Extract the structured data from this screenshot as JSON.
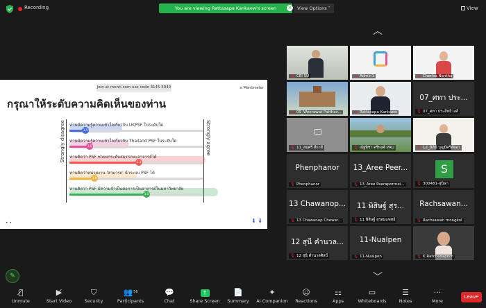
{
  "topbar": {
    "recording_label": "Recording",
    "viewing_banner": "You are viewing Rattasapa Kankaew's screen",
    "view_options": "View Options ˅",
    "view_label": "View"
  },
  "slide": {
    "code_text": "Join at menti.com  use code  3145 5940",
    "brand": "≡ Mentimeter",
    "title": "กรุณาให้ระดับความคิดเห็นของท่าน",
    "left_axis": "Strongly disagree",
    "right_axis": "Strongly agree",
    "footer_left": "•  •",
    "footer_right": "⬇ ⬇",
    "statements": [
      {
        "text": "ท่านมีความรู้ความเข้าใจเกี่ยวกับ UKPSF ในระดับใด",
        "value": "1.5",
        "level": 0.12,
        "color": "#4a6fd8"
      },
      {
        "text": "ท่านมีความรู้ความเข้าใจเกี่ยวกับ Thailand PSF ในระดับใด",
        "value": "1.6",
        "level": 0.15,
        "color": "#e0559a"
      },
      {
        "text": "ท่านคิดว่า PSF ช่วยยกระดับสมรรถนะอาจารย์ได้",
        "value": "3.3",
        "level": 0.52,
        "color": "#f05a5a"
      },
      {
        "text": "ท่านคิดว่าหน่วยงาน 'สามารถ' นำระบบ PSF ได้",
        "value": "1.8",
        "level": 0.19,
        "color": "#f0b24a"
      },
      {
        "text": "ท่านคิดว่า PSF มีความจำเป็นต่อการเป็นอาจารย์ในมหาวิทยาลัย",
        "value": "3.5",
        "level": 0.58,
        "color": "#3fae5a"
      }
    ]
  },
  "participants": [
    {
      "name": "CEI SU",
      "type": "photo",
      "photo": "speaker"
    },
    {
      "name": "Admin1",
      "type": "photo",
      "photo": "logo"
    },
    {
      "name": "Cherlsa Nantha",
      "type": "photo",
      "photo": "woman"
    },
    {
      "name": "09_Weerawat Patthav...",
      "type": "photo",
      "photo": "building"
    },
    {
      "name": "Rattasapa Kankaew",
      "type": "photo",
      "photo": "man"
    },
    {
      "name": "07_ศทา ประสิทธิวงศ์",
      "type": "text",
      "big": "07_ศทา ประ..."
    },
    {
      "name": "11_สมศรี สีกาสี",
      "type": "photo",
      "photo": "gray"
    },
    {
      "name": "ณัฐทิชา ศรีพงศ์ VRU",
      "type": "photo",
      "photo": "landscape"
    },
    {
      "name": "12_นิลินี บุญมีศรีสัจจา",
      "type": "photo",
      "photo": "woman2"
    },
    {
      "name": "Phenphanor",
      "type": "text",
      "big": "Phenphanor"
    },
    {
      "name": "13_Aree Peeraporrnei...",
      "type": "text",
      "big": "13_Aree Peer..."
    },
    {
      "name": "300481-สุนิษา",
      "type": "letter",
      "big": "S"
    },
    {
      "name": "13 Chawanop Chewar...",
      "type": "text",
      "big": "13 Chawanop..."
    },
    {
      "name": "11 พิสิษฐ์ สุรสมแพทย์",
      "type": "text",
      "big": "11 พิสิษฐ์ สุร..."
    },
    {
      "name": "Rachsawan mongkol",
      "type": "text",
      "big": "Rachsawan..."
    },
    {
      "name": "12 สุนี คำนวลศิลป์",
      "type": "text",
      "big": "12 สุนี คำนวล..."
    },
    {
      "name": "11-Nualpen",
      "type": "text",
      "big": "11-Nualpen"
    },
    {
      "name": "K.Ratchadaporn",
      "type": "photo",
      "photo": "woman3"
    }
  ],
  "toolbar": {
    "unmute": "Unmute",
    "start_video": "Start Video",
    "security": "Security",
    "participants": "Participants",
    "participants_count": "56",
    "chat": "Chat",
    "share_screen": "Share Screen",
    "summary": "Summary",
    "ai_companion": "AI Companion",
    "reactions": "Reactions",
    "apps": "Apps",
    "whiteboards": "Whiteboards",
    "notes": "Notes",
    "more": "More",
    "leave": "Leave"
  },
  "colors": {
    "accent_green": "#22c55e",
    "leave_red": "#e02828",
    "background": "#1a1a1a"
  }
}
